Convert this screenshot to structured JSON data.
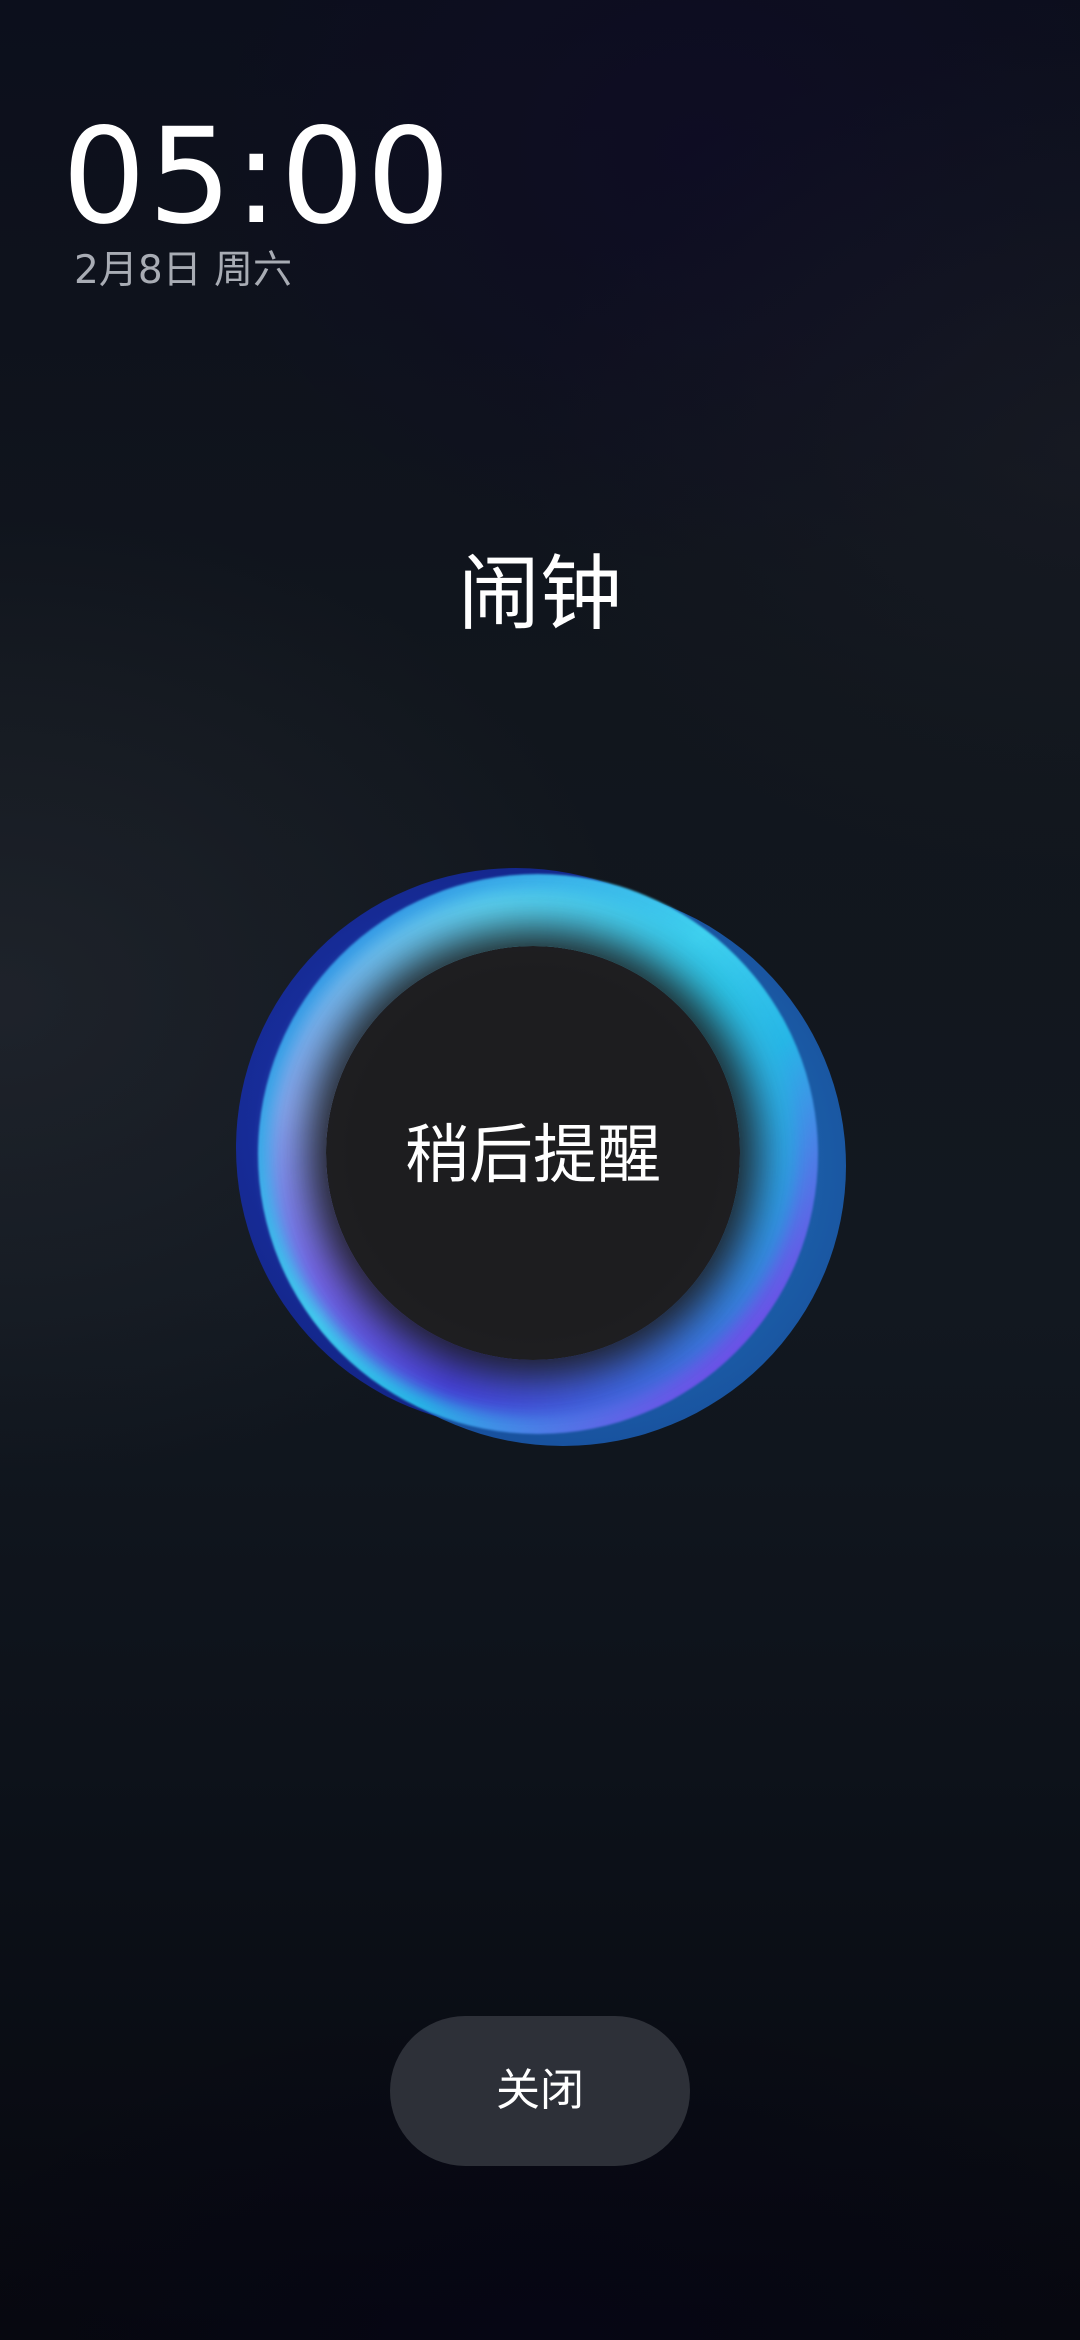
{
  "status": {
    "time": "05:00",
    "date": "2月8日 周六"
  },
  "alarm": {
    "title": "闹钟",
    "snooze_label": "稍后提醒",
    "dismiss_label": "关闭"
  },
  "colors": {
    "background": "#11161d",
    "ring_cyan": "#3fd0ee",
    "ring_violet": "#6a52e6",
    "ring_blue": "#2f7fe0",
    "core": "#1d1d1f",
    "dismiss_button": "#2d3038",
    "date_text": "#a8acb4"
  }
}
